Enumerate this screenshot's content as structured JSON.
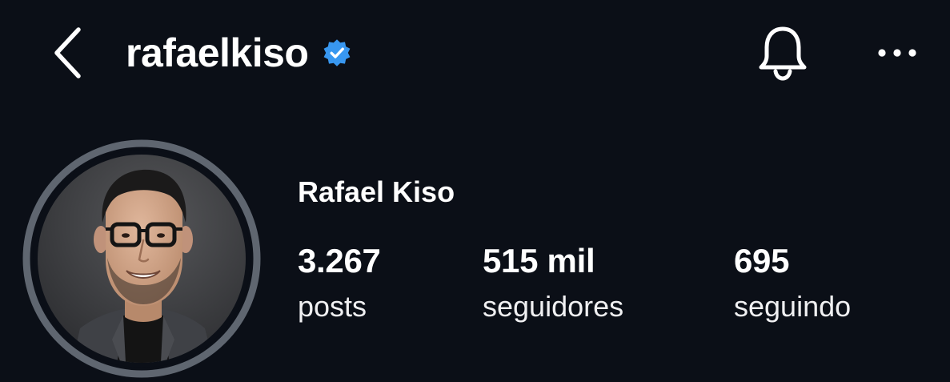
{
  "header": {
    "username": "rafaelkiso",
    "back_icon": "chevron-left-icon",
    "verified_icon": "verified-badge-icon",
    "notification_icon": "bell-icon",
    "more_icon": "more-horizontal-icon"
  },
  "profile": {
    "display_name": "Rafael Kiso",
    "avatar_icon": "profile-photo",
    "stats": {
      "posts": {
        "value": "3.267",
        "label": "posts"
      },
      "followers": {
        "value": "515 mil",
        "label": "seguidores"
      },
      "following": {
        "value": "695",
        "label": "seguindo"
      }
    }
  },
  "colors": {
    "background": "#0b0f17",
    "text": "#ffffff",
    "verified_blue": "#3897f0",
    "avatar_ring": "#5f6670"
  }
}
